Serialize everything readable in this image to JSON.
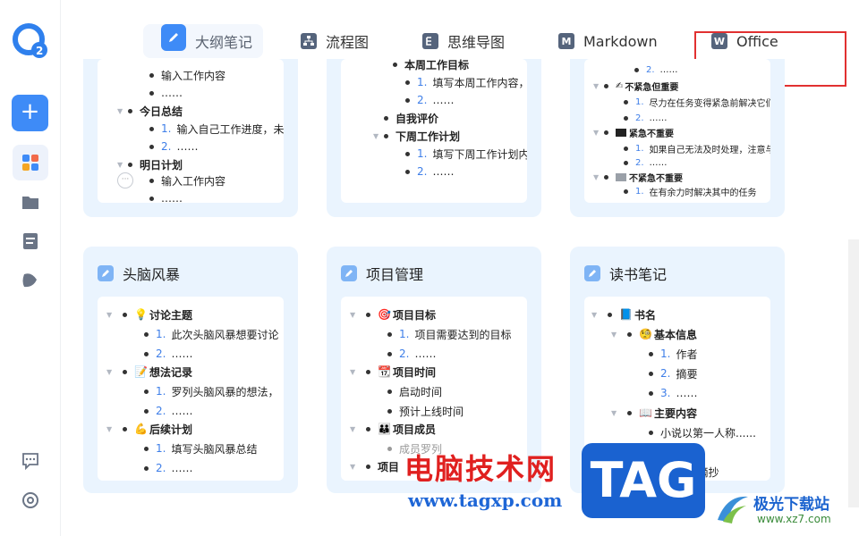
{
  "tabs": [
    {
      "label": "大纲笔记",
      "icon": "outline-note-icon",
      "active": true
    },
    {
      "label": "流程图",
      "icon": "flowchart-icon"
    },
    {
      "label": "思维导图",
      "icon": "mindmap-icon"
    },
    {
      "label": "Markdown",
      "icon": "markdown-icon"
    },
    {
      "label": "Office",
      "icon": "office-icon"
    }
  ],
  "sidebar": {
    "new_label": "+",
    "items": [
      "templates-icon",
      "folder-icon",
      "document-icon",
      "tag-icon"
    ],
    "bottom": [
      "feedback-icon",
      "settings-icon"
    ]
  },
  "top_cards": {
    "c1": [
      "输入工作内容",
      "……",
      "今日总结",
      "1.",
      "输入自己工作进度，未完",
      "2.",
      "……",
      "明日计划",
      "输入工作内容",
      "……"
    ],
    "c2": [
      "本周工作目标",
      "1.",
      "填写本周工作内容，例",
      "2.",
      "……",
      "自我评价",
      "下周工作计划",
      "1.",
      "填写下周工作计划内容",
      "2.",
      "……"
    ],
    "c3": [
      "2.",
      "……",
      "✍",
      "不紧急但重要",
      "1.",
      "尽力在任务变得紧急前解决它们",
      "2.",
      "……",
      "紧急不重要",
      "1.",
      "如果自己无法及时处理，注意与他",
      "2.",
      "……",
      "不紧急不重要",
      "1.",
      "在有余力时解决其中的任务"
    ]
  },
  "cards": [
    {
      "title": "头脑风暴",
      "rows": [
        "💡",
        "讨论主题",
        "1.",
        "此次头脑风暴想要讨论",
        "2.",
        "……",
        "📝",
        "想法记录",
        "1.",
        "罗列头脑风暴的想法，",
        "2.",
        "……",
        "💪",
        "后续计划",
        "1.",
        "填写头脑风暴总结",
        "2.",
        "……"
      ]
    },
    {
      "title": "项目管理",
      "rows": [
        "🎯",
        "项目目标",
        "1.",
        "项目需要达到的目标",
        "2.",
        "……",
        "📆",
        "项目时间",
        "启动时间",
        "预计上线时间",
        "👪",
        "项目成员",
        "成员罗列",
        "项目"
      ]
    },
    {
      "title": "读书笔记",
      "rows": [
        "📘",
        "书名",
        "🧐",
        "基本信息",
        "1.",
        "作者",
        "2.",
        "摘要",
        "3.",
        "……",
        "📖",
        "主要内容",
        "小说以第一人称......",
        "摘抄",
        "1.",
        "金句摘抄"
      ]
    }
  ],
  "watermark": {
    "cn": "电脑技术网",
    "url": "www.tagxp.com",
    "tag": "TAG",
    "site_cn": "极光下载站",
    "site_url": "www.xz7.com"
  },
  "colors": {
    "accent": "#3e8bf7",
    "card_bg": "#eaf4fe",
    "number": "#3e7ee8",
    "highlight": "#e13030"
  }
}
